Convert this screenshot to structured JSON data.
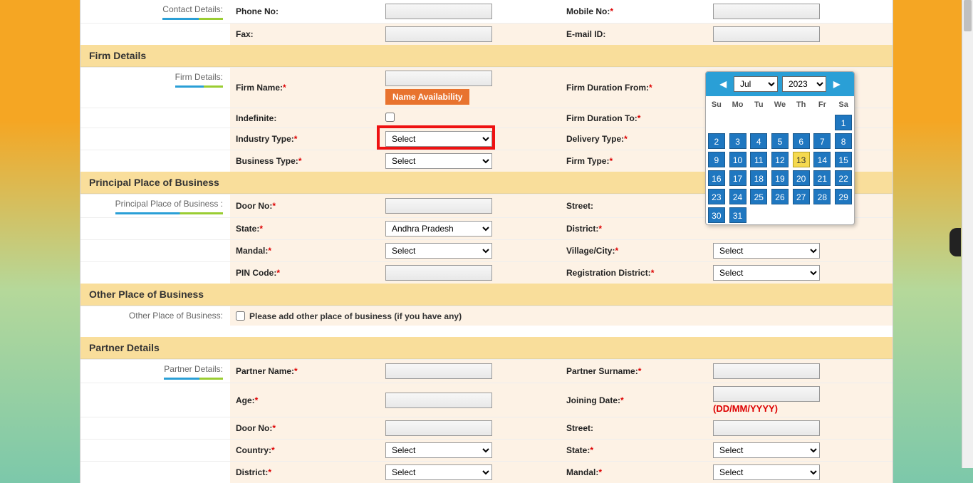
{
  "sections": {
    "contact": {
      "title_label": "Contact Details:",
      "phone_label": "Phone No:",
      "mobile_label": "Mobile No:",
      "fax_label": "Fax:",
      "email_label": "E-mail ID:"
    },
    "firm": {
      "header": "Firm Details",
      "title_label": "Firm Details:",
      "firm_name_label": "Firm Name:",
      "name_avail_btn": "Name Availability",
      "duration_from_label": "Firm Duration From:",
      "indefinite_label": "Indefinite:",
      "duration_to_label": "Firm Duration To:",
      "industry_type_label": "Industry Type:",
      "delivery_type_label": "Delivery Type:",
      "business_type_label": "Business Type:",
      "firm_type_label": "Firm Type:"
    },
    "ppb": {
      "header": "Principal Place of Business",
      "title_label": "Principal Place of Business :",
      "door_label": "Door No:",
      "street_label": "Street:",
      "state_label": "State:",
      "state_value": "Andhra Pradesh",
      "district_label": "District:",
      "mandal_label": "Mandal:",
      "village_label": "Village/City:",
      "pin_label": "PIN Code:",
      "reg_dist_label": "Registration District:"
    },
    "opb": {
      "header": "Other Place of Business",
      "title_label": "Other Place of Business:",
      "checkbox_label": "Please add other place of business (if you have any)"
    },
    "partner": {
      "header": "Partner Details",
      "title_label": "Partner Details:",
      "name_label": "Partner Name:",
      "surname_label": "Partner Surname:",
      "age_label": "Age:",
      "joining_label": "Joining Date:",
      "date_note": "(DD/MM/YYYY)",
      "door_label": "Door No:",
      "street_label": "Street:",
      "country_label": "Country:",
      "state_label": "State:",
      "district_label": "District:",
      "mandal_label": "Mandal:"
    }
  },
  "select_default": "Select",
  "datepicker": {
    "month": "Jul",
    "year": "2023",
    "dow": [
      "Su",
      "Mo",
      "Tu",
      "We",
      "Th",
      "Fr",
      "Sa"
    ],
    "weeks": [
      [
        "",
        "",
        "",
        "",
        "",
        "",
        "1"
      ],
      [
        "2",
        "3",
        "4",
        "5",
        "6",
        "7",
        "8"
      ],
      [
        "9",
        "10",
        "11",
        "12",
        "13",
        "14",
        "15"
      ],
      [
        "16",
        "17",
        "18",
        "19",
        "20",
        "21",
        "22"
      ],
      [
        "23",
        "24",
        "25",
        "26",
        "27",
        "28",
        "29"
      ],
      [
        "30",
        "31",
        "",
        "",
        "",
        "",
        ""
      ]
    ],
    "today": "13"
  }
}
